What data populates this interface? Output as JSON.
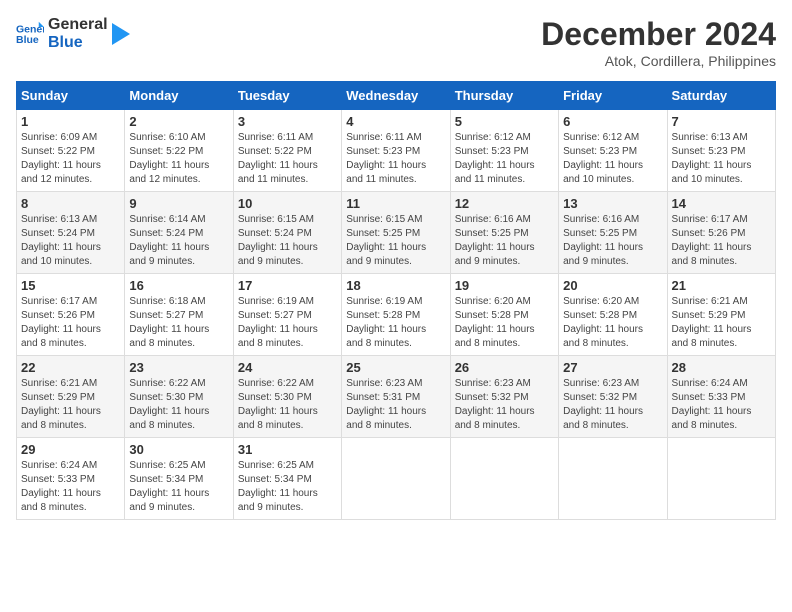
{
  "header": {
    "logo_line1": "General",
    "logo_line2": "Blue",
    "month_title": "December 2024",
    "location": "Atok, Cordillera, Philippines"
  },
  "weekdays": [
    "Sunday",
    "Monday",
    "Tuesday",
    "Wednesday",
    "Thursday",
    "Friday",
    "Saturday"
  ],
  "weeks": [
    [
      {
        "day": "1",
        "info": "Sunrise: 6:09 AM\nSunset: 5:22 PM\nDaylight: 11 hours\nand 12 minutes."
      },
      {
        "day": "2",
        "info": "Sunrise: 6:10 AM\nSunset: 5:22 PM\nDaylight: 11 hours\nand 12 minutes."
      },
      {
        "day": "3",
        "info": "Sunrise: 6:11 AM\nSunset: 5:22 PM\nDaylight: 11 hours\nand 11 minutes."
      },
      {
        "day": "4",
        "info": "Sunrise: 6:11 AM\nSunset: 5:23 PM\nDaylight: 11 hours\nand 11 minutes."
      },
      {
        "day": "5",
        "info": "Sunrise: 6:12 AM\nSunset: 5:23 PM\nDaylight: 11 hours\nand 11 minutes."
      },
      {
        "day": "6",
        "info": "Sunrise: 6:12 AM\nSunset: 5:23 PM\nDaylight: 11 hours\nand 10 minutes."
      },
      {
        "day": "7",
        "info": "Sunrise: 6:13 AM\nSunset: 5:23 PM\nDaylight: 11 hours\nand 10 minutes."
      }
    ],
    [
      {
        "day": "8",
        "info": "Sunrise: 6:13 AM\nSunset: 5:24 PM\nDaylight: 11 hours\nand 10 minutes."
      },
      {
        "day": "9",
        "info": "Sunrise: 6:14 AM\nSunset: 5:24 PM\nDaylight: 11 hours\nand 9 minutes."
      },
      {
        "day": "10",
        "info": "Sunrise: 6:15 AM\nSunset: 5:24 PM\nDaylight: 11 hours\nand 9 minutes."
      },
      {
        "day": "11",
        "info": "Sunrise: 6:15 AM\nSunset: 5:25 PM\nDaylight: 11 hours\nand 9 minutes."
      },
      {
        "day": "12",
        "info": "Sunrise: 6:16 AM\nSunset: 5:25 PM\nDaylight: 11 hours\nand 9 minutes."
      },
      {
        "day": "13",
        "info": "Sunrise: 6:16 AM\nSunset: 5:25 PM\nDaylight: 11 hours\nand 9 minutes."
      },
      {
        "day": "14",
        "info": "Sunrise: 6:17 AM\nSunset: 5:26 PM\nDaylight: 11 hours\nand 8 minutes."
      }
    ],
    [
      {
        "day": "15",
        "info": "Sunrise: 6:17 AM\nSunset: 5:26 PM\nDaylight: 11 hours\nand 8 minutes."
      },
      {
        "day": "16",
        "info": "Sunrise: 6:18 AM\nSunset: 5:27 PM\nDaylight: 11 hours\nand 8 minutes."
      },
      {
        "day": "17",
        "info": "Sunrise: 6:19 AM\nSunset: 5:27 PM\nDaylight: 11 hours\nand 8 minutes."
      },
      {
        "day": "18",
        "info": "Sunrise: 6:19 AM\nSunset: 5:28 PM\nDaylight: 11 hours\nand 8 minutes."
      },
      {
        "day": "19",
        "info": "Sunrise: 6:20 AM\nSunset: 5:28 PM\nDaylight: 11 hours\nand 8 minutes."
      },
      {
        "day": "20",
        "info": "Sunrise: 6:20 AM\nSunset: 5:28 PM\nDaylight: 11 hours\nand 8 minutes."
      },
      {
        "day": "21",
        "info": "Sunrise: 6:21 AM\nSunset: 5:29 PM\nDaylight: 11 hours\nand 8 minutes."
      }
    ],
    [
      {
        "day": "22",
        "info": "Sunrise: 6:21 AM\nSunset: 5:29 PM\nDaylight: 11 hours\nand 8 minutes."
      },
      {
        "day": "23",
        "info": "Sunrise: 6:22 AM\nSunset: 5:30 PM\nDaylight: 11 hours\nand 8 minutes."
      },
      {
        "day": "24",
        "info": "Sunrise: 6:22 AM\nSunset: 5:30 PM\nDaylight: 11 hours\nand 8 minutes."
      },
      {
        "day": "25",
        "info": "Sunrise: 6:23 AM\nSunset: 5:31 PM\nDaylight: 11 hours\nand 8 minutes."
      },
      {
        "day": "26",
        "info": "Sunrise: 6:23 AM\nSunset: 5:32 PM\nDaylight: 11 hours\nand 8 minutes."
      },
      {
        "day": "27",
        "info": "Sunrise: 6:23 AM\nSunset: 5:32 PM\nDaylight: 11 hours\nand 8 minutes."
      },
      {
        "day": "28",
        "info": "Sunrise: 6:24 AM\nSunset: 5:33 PM\nDaylight: 11 hours\nand 8 minutes."
      }
    ],
    [
      {
        "day": "29",
        "info": "Sunrise: 6:24 AM\nSunset: 5:33 PM\nDaylight: 11 hours\nand 8 minutes."
      },
      {
        "day": "30",
        "info": "Sunrise: 6:25 AM\nSunset: 5:34 PM\nDaylight: 11 hours\nand 9 minutes."
      },
      {
        "day": "31",
        "info": "Sunrise: 6:25 AM\nSunset: 5:34 PM\nDaylight: 11 hours\nand 9 minutes."
      },
      null,
      null,
      null,
      null
    ]
  ]
}
